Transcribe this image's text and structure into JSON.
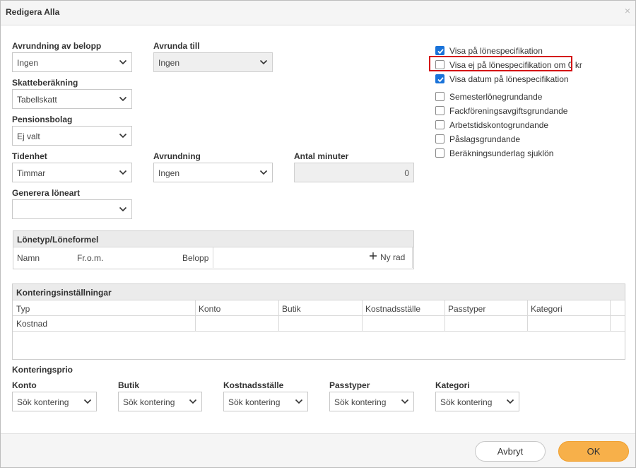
{
  "dialog": {
    "title": "Redigera Alla",
    "close_symbol": "×"
  },
  "fields": {
    "avrundning_belopp": {
      "label": "Avrundning av belopp",
      "value": "Ingen"
    },
    "avrunda_till": {
      "label": "Avrunda till",
      "value": "Ingen"
    },
    "skatteberakning": {
      "label": "Skatteberäkning",
      "value": "Tabellskatt"
    },
    "pensionsbolag": {
      "label": "Pensionsbolag",
      "value": "Ej valt"
    },
    "tidenhet": {
      "label": "Tidenhet",
      "value": "Timmar"
    },
    "avrundning": {
      "label": "Avrundning",
      "value": "Ingen"
    },
    "antal_minuter": {
      "label": "Antal minuter",
      "value": "0"
    },
    "generera_loneart": {
      "label": "Generera löneart",
      "value": ""
    }
  },
  "checkboxes": [
    {
      "label": "Visa på lönespecifikation",
      "checked": true
    },
    {
      "label": "Visa ej på lönespecifikation om 0 kr",
      "checked": false
    },
    {
      "label": "Visa datum på lönespecifikation",
      "checked": true
    },
    {
      "label": "Semesterlönegrundande",
      "checked": false
    },
    {
      "label": "Fackföreningsavgiftsgrundande",
      "checked": false
    },
    {
      "label": "Arbetstidskontogrundande",
      "checked": false
    },
    {
      "label": "Påslagsgrundande",
      "checked": false
    },
    {
      "label": "Beräkningsunderlag sjuklön",
      "checked": false
    }
  ],
  "lonetyp": {
    "title": "Lönetyp/Löneformel",
    "columns": [
      "Namn",
      "Fr.o.m.",
      "Belopp"
    ],
    "add_row": "Ny rad"
  },
  "kontering": {
    "title": "Konteringsinställningar",
    "columns": [
      "Typ",
      "Konto",
      "Butik",
      "Kostnadsställe",
      "Passtyper",
      "Kategori"
    ],
    "rows": [
      [
        "Kostnad",
        "",
        "",
        "",
        "",
        ""
      ]
    ]
  },
  "konteringsprio": {
    "title": "Konteringsprio",
    "items": [
      {
        "label": "Konto",
        "value": "Sök kontering"
      },
      {
        "label": "Butik",
        "value": "Sök kontering"
      },
      {
        "label": "Kostnadsställe",
        "value": "Sök kontering"
      },
      {
        "label": "Passtyper",
        "value": "Sök kontering"
      },
      {
        "label": "Kategori",
        "value": "Sök kontering"
      }
    ]
  },
  "buttons": {
    "cancel": "Avbryt",
    "ok": "OK"
  },
  "colors": {
    "checkbox_checked": "#1a73d9",
    "highlight": "#d40f14",
    "ok_button": "#f7b04a"
  }
}
